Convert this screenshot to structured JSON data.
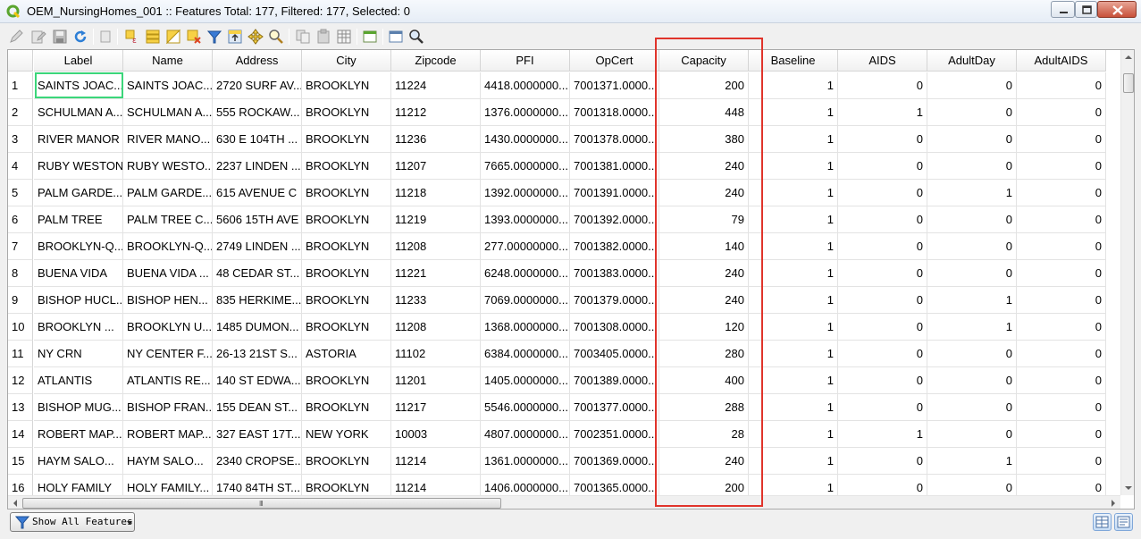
{
  "window": {
    "title": "OEM_NursingHomes_001 :: Features Total: 177, Filtered: 177, Selected: 0"
  },
  "toolbar": {
    "icons": [
      "toggle-edit-icon",
      "toggle-multiedit-icon",
      "save-edits-icon",
      "reload-icon",
      "add-feature-icon",
      "delete-feature-icon",
      "select-by-expression-icon",
      "select-all-icon",
      "invert-selection-icon",
      "deselect-all-icon",
      "filter-select-icon",
      "move-selection-top-icon",
      "pan-to-selection-icon",
      "zoom-to-selection-icon",
      "copy-rows-icon",
      "paste-features-icon",
      "delete-field-icon",
      "new-field-icon",
      "field-calculator-icon",
      "conditional-formatting-icon",
      "actions-icon",
      "zoom-map-icon"
    ]
  },
  "table": {
    "columns": [
      "Label",
      "Name",
      "Address",
      "City",
      "Zipcode",
      "PFI",
      "OpCert",
      "Capacity",
      "Baseline",
      "AIDS",
      "AdultDay",
      "AdultAIDS"
    ],
    "rows": [
      {
        "n": "1",
        "cells": [
          "SAINTS JOAC...",
          "SAINTS JOAC...",
          "2720 SURF AV...",
          "BROOKLYN",
          "11224",
          "4418.0000000...",
          "7001371.0000...",
          "200",
          "1",
          "0",
          "0",
          "0"
        ]
      },
      {
        "n": "2",
        "cells": [
          "SCHULMAN A...",
          "SCHULMAN A...",
          "555 ROCKAW...",
          "BROOKLYN",
          "11212",
          "1376.0000000...",
          "7001318.0000...",
          "448",
          "1",
          "1",
          "0",
          "0"
        ]
      },
      {
        "n": "3",
        "cells": [
          "RIVER MANOR",
          "RIVER MANO...",
          "630 E 104TH ...",
          "BROOKLYN",
          "11236",
          "1430.0000000...",
          "7001378.0000...",
          "380",
          "1",
          "0",
          "0",
          "0"
        ]
      },
      {
        "n": "4",
        "cells": [
          "RUBY WESTON",
          "RUBY WESTO...",
          "2237 LINDEN ...",
          "BROOKLYN",
          "11207",
          "7665.0000000...",
          "7001381.0000...",
          "240",
          "1",
          "0",
          "0",
          "0"
        ]
      },
      {
        "n": "5",
        "cells": [
          "PALM GARDE...",
          "PALM GARDE...",
          "615 AVENUE C",
          "BROOKLYN",
          "11218",
          "1392.0000000...",
          "7001391.0000...",
          "240",
          "1",
          "0",
          "1",
          "0"
        ]
      },
      {
        "n": "6",
        "cells": [
          "PALM TREE",
          "PALM TREE C...",
          "5606 15TH AVE",
          "BROOKLYN",
          "11219",
          "1393.0000000...",
          "7001392.0000...",
          "79",
          "1",
          "0",
          "0",
          "0"
        ]
      },
      {
        "n": "7",
        "cells": [
          "BROOKLYN-Q...",
          "BROOKLYN-Q...",
          "2749 LINDEN ...",
          "BROOKLYN",
          "11208",
          "277.00000000...",
          "7001382.0000...",
          "140",
          "1",
          "0",
          "0",
          "0"
        ]
      },
      {
        "n": "8",
        "cells": [
          "BUENA VIDA",
          "BUENA VIDA ...",
          "48 CEDAR ST...",
          "BROOKLYN",
          "11221",
          "6248.0000000...",
          "7001383.0000...",
          "240",
          "1",
          "0",
          "0",
          "0"
        ]
      },
      {
        "n": "9",
        "cells": [
          "BISHOP HUCL...",
          "BISHOP HEN...",
          "835 HERKIME...",
          "BROOKLYN",
          "11233",
          "7069.0000000...",
          "7001379.0000...",
          "240",
          "1",
          "0",
          "1",
          "0"
        ]
      },
      {
        "n": "10",
        "cells": [
          "BROOKLYN ...",
          "BROOKLYN U...",
          "1485 DUMON...",
          "BROOKLYN",
          "11208",
          "1368.0000000...",
          "7001308.0000...",
          "120",
          "1",
          "0",
          "1",
          "0"
        ]
      },
      {
        "n": "11",
        "cells": [
          "NY CRN",
          "NY CENTER F...",
          "26-13 21ST S...",
          "ASTORIA",
          "11102",
          "6384.0000000...",
          "7003405.0000...",
          "280",
          "1",
          "0",
          "0",
          "0"
        ]
      },
      {
        "n": "12",
        "cells": [
          "ATLANTIS",
          "ATLANTIS RE...",
          "140 ST EDWA...",
          "BROOKLYN",
          "11201",
          "1405.0000000...",
          "7001389.0000...",
          "400",
          "1",
          "0",
          "0",
          "0"
        ]
      },
      {
        "n": "13",
        "cells": [
          "BISHOP MUG...",
          "BISHOP FRAN...",
          "155 DEAN ST...",
          "BROOKLYN",
          "11217",
          "5546.0000000...",
          "7001377.0000...",
          "288",
          "1",
          "0",
          "0",
          "0"
        ]
      },
      {
        "n": "14",
        "cells": [
          "ROBERT MAP...",
          "ROBERT MAP...",
          "327 EAST 17T...",
          "NEW YORK",
          "10003",
          "4807.0000000...",
          "7002351.0000...",
          "28",
          "1",
          "1",
          "0",
          "0"
        ]
      },
      {
        "n": "15",
        "cells": [
          "HAYM  SALO...",
          "HAYM SALO...",
          "2340 CROPSE...",
          "BROOKLYN",
          "11214",
          "1361.0000000...",
          "7001369.0000...",
          "240",
          "1",
          "0",
          "1",
          "0"
        ]
      },
      {
        "n": "16",
        "cells": [
          "HOLY  FAMILY",
          "HOLY FAMILY...",
          "1740 84TH ST...",
          "BROOKLYN",
          "11214",
          "1406.0000000...",
          "7001365.0000...",
          "200",
          "1",
          "0",
          "0",
          "0"
        ]
      }
    ],
    "numeric_columns": [
      7,
      8,
      9,
      10,
      11
    ],
    "current_cell": {
      "row": 1,
      "column": "Label"
    },
    "annotation": {
      "column": "Capacity",
      "color": "#e0342b"
    },
    "current_cell_color": "#3bd67a"
  },
  "scrollbar": {
    "grip": "III"
  },
  "bottom": {
    "show_features_label": "Show All Features",
    "view_buttons": [
      "table-view-icon",
      "form-view-icon"
    ]
  }
}
